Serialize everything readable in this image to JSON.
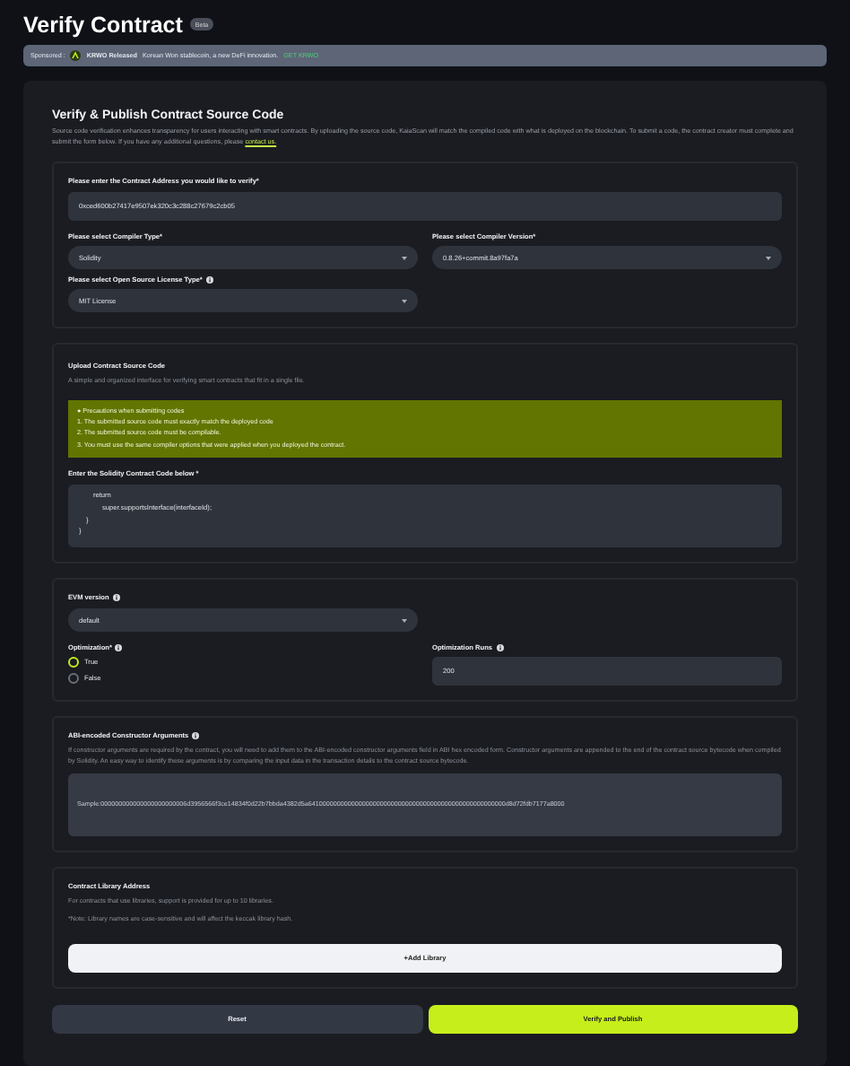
{
  "page": {
    "title": "Verify Contract",
    "badge": "Beta"
  },
  "sponsor": {
    "label": "Sponsored :",
    "name": "KRWO Released",
    "text": "Korean Won stablecoin, a new DeFi innovation.",
    "link": "GET KRWO"
  },
  "form": {
    "heading": "Verify & Publish Contract Source Code",
    "description": "Source code verification enhances transparency for users interacting with smart contracts. By uploading the source code, KaiaScan will match the compiled code with what is deployed on the blockchain. To submit a code, the contract creator must complete and submit the form below. If you have any additional questions, please",
    "contact_link": "contact us."
  },
  "address_section": {
    "address_label": "Please enter the Contract Address you would like to verify*",
    "address_value": "0xced600b27417e9507ek320c3c288c27679c2cb05",
    "compiler_type": {
      "label": "Please select Compiler Type*",
      "value": "Solidity"
    },
    "compiler_version": {
      "label": "Please select Compiler Version*",
      "value": "0.8.26+commit.8a97fa7a"
    },
    "license": {
      "label": "Please select Open Source License Type*",
      "value": "MIT License"
    }
  },
  "upload_section": {
    "title": "Upload Contract Source Code",
    "subtitle": "A simple and organized interface for verifying smart contracts that fit in a single file.",
    "notice": [
      "● Precautions when submitting codes",
      "1. The submitted source code must exactly match the deployed code",
      "2. The submitted source code must be compilable.",
      "3. You must use the same compiler options that were applied when you deployed the contract."
    ],
    "code_label": "Enter the Solidity Contract Code below *",
    "code_lines": [
      "return",
      "super.supportsInterface(interfaceId);",
      "}",
      "}"
    ]
  },
  "options_section": {
    "evm_label": "EVM version",
    "evm_value": "default",
    "optimization_label": "Optimization*",
    "optimization_options": [
      {
        "label": "True",
        "selected": true
      },
      {
        "label": "False",
        "selected": false
      }
    ],
    "runs_label": "Optimization Runs",
    "runs_value": "200"
  },
  "abi_section": {
    "title": "ABI-encoded Constructor Arguments",
    "description": "If constructor arguments are required by the contract, you will need to add them to the ABI-encoded constructor arguments field in ABI hex encoded form. Constructor arguments are appended to the end of the contract source bytecode when compiled by Solidity. An easy way to identify these arguments is by comparing the input data in the transaction details to the contract source bytecode.",
    "value": "Sample:000000000000000000000006d3956566f3ce14834f0d22b7bbda4382d5a6410000000000000000000000000000000000000000000000000000d8d72fdb7177a8000"
  },
  "library_section": {
    "title": "Contract Library Address",
    "lines": [
      "For contracts that use libraries, support is provided for up to 10 libraries.",
      "*Note: Library names are case-sensitive and will affect the keccak library hash."
    ],
    "button": "+Add Library"
  },
  "buttons": {
    "reset": "Reset",
    "submit": "Verify and Publish"
  }
}
